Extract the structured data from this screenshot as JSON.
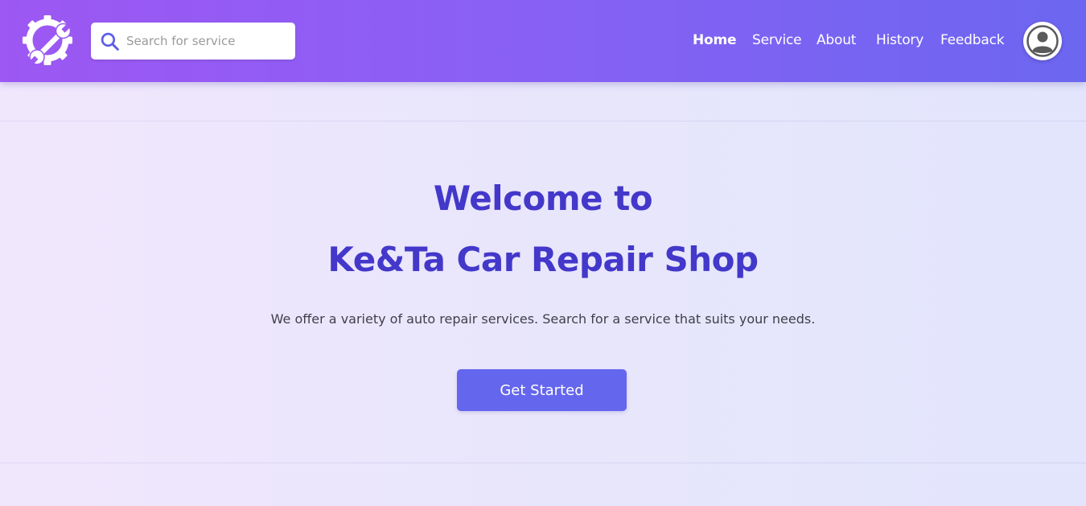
{
  "header": {
    "logo_icon": "gear-wrench-icon",
    "search": {
      "placeholder": "Search for service",
      "value": "",
      "icon": "search-icon"
    },
    "nav": [
      {
        "label": "Home",
        "active": true
      },
      {
        "label": "Service",
        "active": false
      },
      {
        "label": "About",
        "active": false
      },
      {
        "label": "History",
        "active": false
      },
      {
        "label": "Feedback",
        "active": false
      }
    ],
    "avatar_icon": "user-circle-icon"
  },
  "hero": {
    "title_line1": "Welcome to",
    "title_line2": "Ke&Ta Car Repair Shop",
    "subtitle": "We offer a variety of auto repair services. Search for a service that suits your needs.",
    "cta_label": "Get Started"
  },
  "colors": {
    "header_gradient_start": "#9d57f3",
    "header_gradient_end": "#6c66f1",
    "title": "#4338ca",
    "button": "#6466ee",
    "search_icon": "#5b5fe6"
  }
}
